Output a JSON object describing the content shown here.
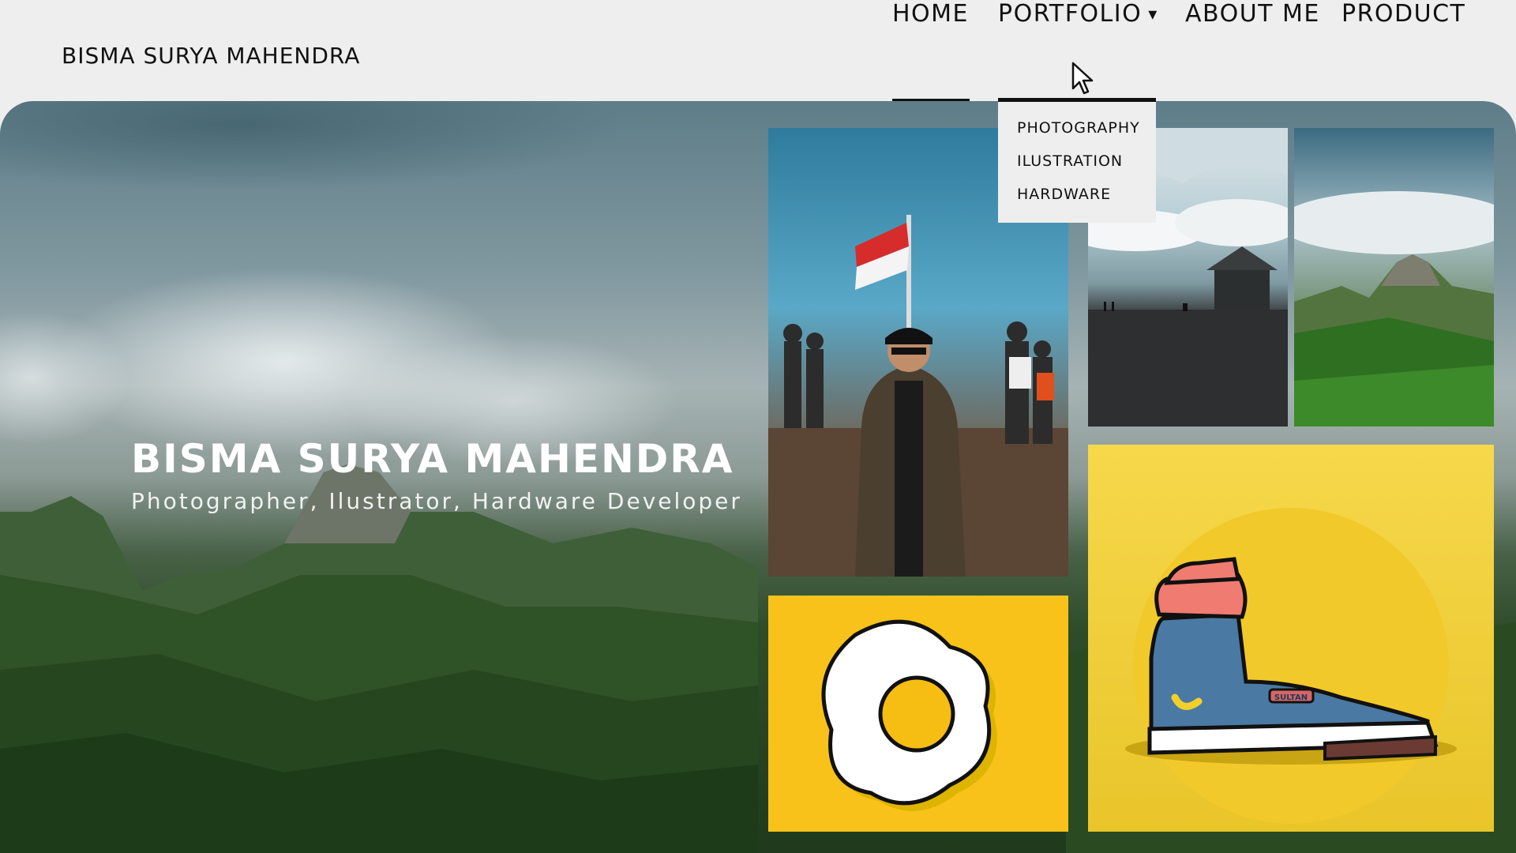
{
  "header": {
    "brand": "BISMA SURYA MAHENDRA",
    "nav": {
      "home": "HOME",
      "portfolio": "PORTFOLIO",
      "about": "ABOUT ME",
      "product": "PRODUCT"
    },
    "active": "home",
    "portfolio_menu": [
      "PHOTOGRAPHY",
      "ILUSTRATION",
      "HARDWARE"
    ]
  },
  "hero": {
    "title": "BISMA SURYA MAHENDRA",
    "subtitle": "Photographer, Ilustrator, Hardware Developer"
  },
  "gallery": [
    {
      "name": "person-with-flag-photo",
      "kind": "photo"
    },
    {
      "name": "misty-beach-hut-photo",
      "kind": "photo"
    },
    {
      "name": "green-mountain-photo",
      "kind": "photo"
    },
    {
      "name": "fried-egg-illustration",
      "kind": "illustration"
    },
    {
      "name": "sneaker-illustration",
      "kind": "illustration",
      "label": "SULTAN"
    }
  ],
  "colors": {
    "nav_bg": "#eeeeee",
    "text": "#111111",
    "egg_bg": "#f8c21a",
    "shoe_bg": "#f6d84b"
  }
}
